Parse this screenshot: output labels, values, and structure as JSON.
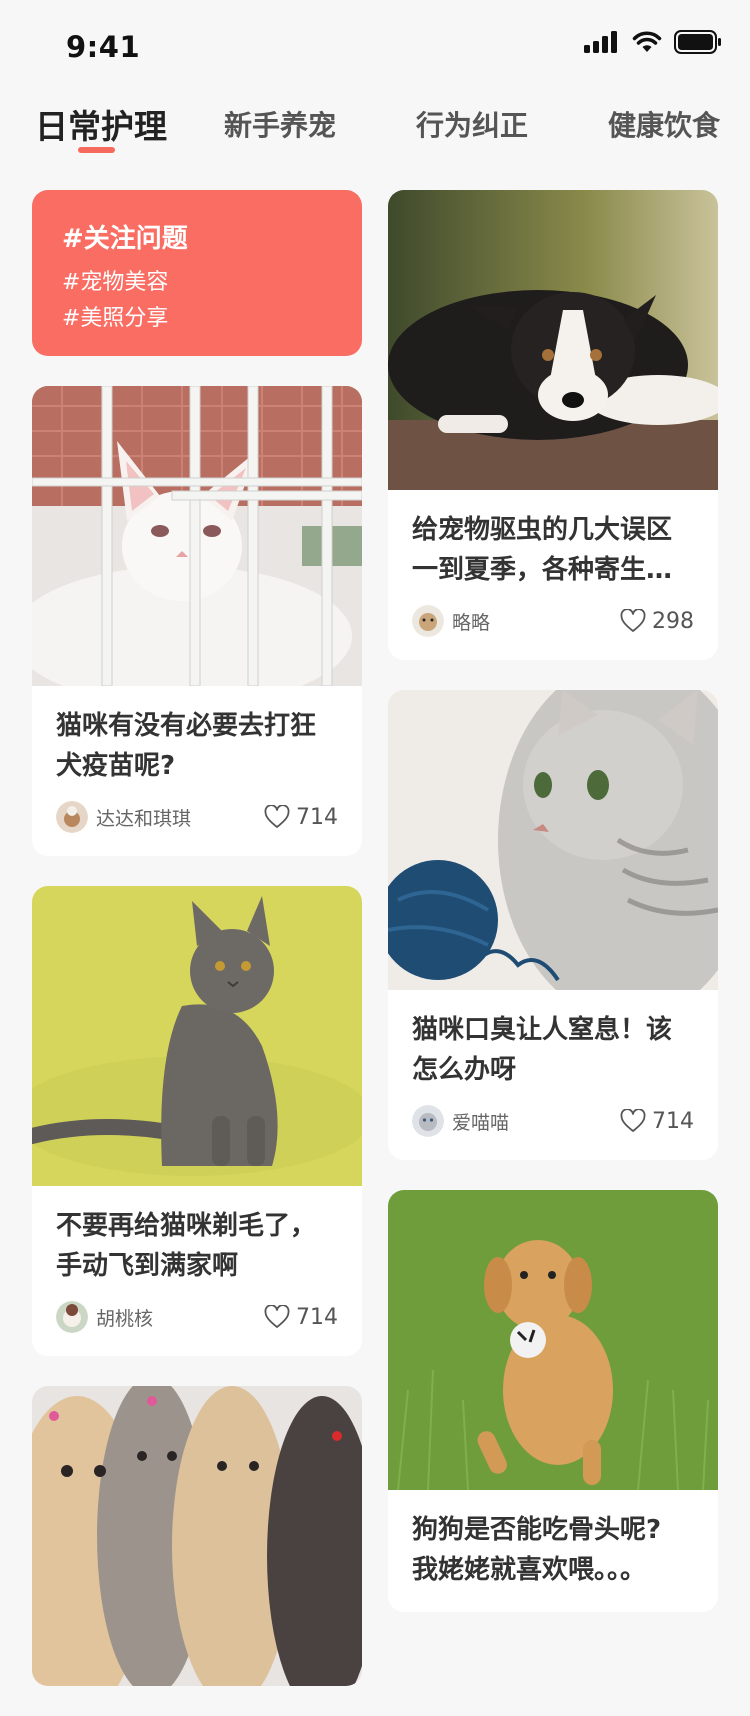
{
  "status_bar": {
    "time": "9:41"
  },
  "tabs": [
    {
      "label": "日常护理",
      "active": true
    },
    {
      "label": "新手养宠",
      "active": false
    },
    {
      "label": "行为纠正",
      "active": false
    },
    {
      "label": "健康饮食",
      "active": false
    }
  ],
  "topic_card": {
    "line1": "#关注问题",
    "line2": "#宠物美容",
    "line3": "#美照分享"
  },
  "cards": {
    "cat_vaccine": {
      "title": "猫咪有没有必要去打狂犬疫苗呢?",
      "author": "达达和琪琪",
      "likes": "714",
      "image": "white-cat-in-cage"
    },
    "cat_shave": {
      "title": "不要再给猫咪剃毛了，手动飞到满家啊",
      "author": "胡桃核",
      "likes": "714",
      "image": "grey-cat-yellow-background"
    },
    "dogs_group": {
      "image": "group-of-long-haired-dogs"
    },
    "deworm": {
      "title": "给宠物驱虫的几大误区一到夏季，各种寄生虫都出来了",
      "author": "略略",
      "likes": "298",
      "image": "border-collie-lying"
    },
    "cat_breath": {
      "title": "猫咪口臭让人窒息！该怎么办呀",
      "author": "爱喵喵",
      "likes": "714",
      "image": "tabby-cat-with-yarn"
    },
    "dog_bone": {
      "title": "狗狗是否能吃骨头呢? 我姥姥就喜欢喂。。。",
      "image": "golden-retriever-running"
    }
  },
  "colors": {
    "accent": "#fa6d63",
    "background": "#f7f7f7",
    "card": "#ffffff"
  }
}
